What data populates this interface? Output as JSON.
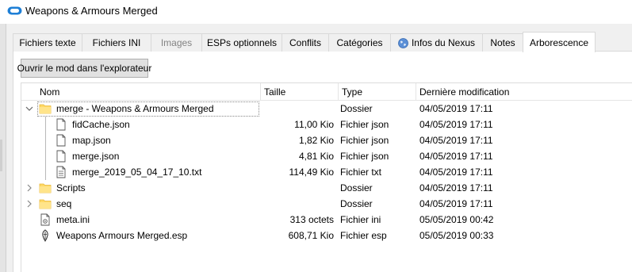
{
  "window": {
    "title": "Weapons & Armours Merged",
    "icon": "mo2-mod-icon"
  },
  "tabs": [
    {
      "label": "Fichiers texte",
      "state": "normal"
    },
    {
      "label": "Fichiers INI",
      "state": "normal"
    },
    {
      "label": "Images",
      "state": "disabled"
    },
    {
      "label": "ESPs optionnels",
      "state": "normal"
    },
    {
      "label": "Conflits",
      "state": "normal"
    },
    {
      "label": "Catégories",
      "state": "normal"
    },
    {
      "label": "Infos du Nexus",
      "state": "normal",
      "icon": "globe-icon"
    },
    {
      "label": "Notes",
      "state": "normal"
    },
    {
      "label": "Arborescence",
      "state": "active"
    }
  ],
  "toolbar": {
    "open_mod_label": "Ouvrir le mod dans l'explorateur"
  },
  "tree": {
    "columns": {
      "name": "Nom",
      "size": "Taille",
      "type": "Type",
      "modified": "Dernière modification"
    },
    "rows": [
      {
        "name": "merge - Weapons & Armours Merged",
        "size": "",
        "type": "Dossier",
        "modified": "04/05/2019 17:11",
        "icon": "folder-icon",
        "level": 0,
        "expander": "expanded",
        "selected": true
      },
      {
        "name": "fidCache.json",
        "size": "11,00 Kio",
        "type": "Fichier json",
        "modified": "04/05/2019 17:11",
        "icon": "file-icon",
        "level": 1,
        "expander": "none"
      },
      {
        "name": "map.json",
        "size": "1,82 Kio",
        "type": "Fichier json",
        "modified": "04/05/2019 17:11",
        "icon": "file-icon",
        "level": 1,
        "expander": "none"
      },
      {
        "name": "merge.json",
        "size": "4,81 Kio",
        "type": "Fichier json",
        "modified": "04/05/2019 17:11",
        "icon": "file-icon",
        "level": 1,
        "expander": "none"
      },
      {
        "name": "merge_2019_05_04_17_10.txt",
        "size": "114,49 Kio",
        "type": "Fichier txt",
        "modified": "04/05/2019 17:11",
        "icon": "text-file-icon",
        "level": 1,
        "expander": "none"
      },
      {
        "name": "Scripts",
        "size": "",
        "type": "Dossier",
        "modified": "04/05/2019 17:11",
        "icon": "folder-icon",
        "level": 0,
        "expander": "collapsed"
      },
      {
        "name": "seq",
        "size": "",
        "type": "Dossier",
        "modified": "04/05/2019 17:11",
        "icon": "folder-icon",
        "level": 0,
        "expander": "collapsed"
      },
      {
        "name": "meta.ini",
        "size": "313 octets",
        "type": "Fichier ini",
        "modified": "05/05/2019 00:42",
        "icon": "ini-file-icon",
        "level": 0,
        "expander": "none"
      },
      {
        "name": "Weapons Armours Merged.esp",
        "size": "608,71 Kio",
        "type": "Fichier esp",
        "modified": "05/05/2019 00:33",
        "icon": "esp-file-icon",
        "level": 0,
        "expander": "none"
      }
    ]
  },
  "colors": {
    "folder": "#ffd966",
    "folder_dark": "#e8b83a",
    "tab_border": "#d9d9d9",
    "button_face": "#e1e1e1"
  }
}
